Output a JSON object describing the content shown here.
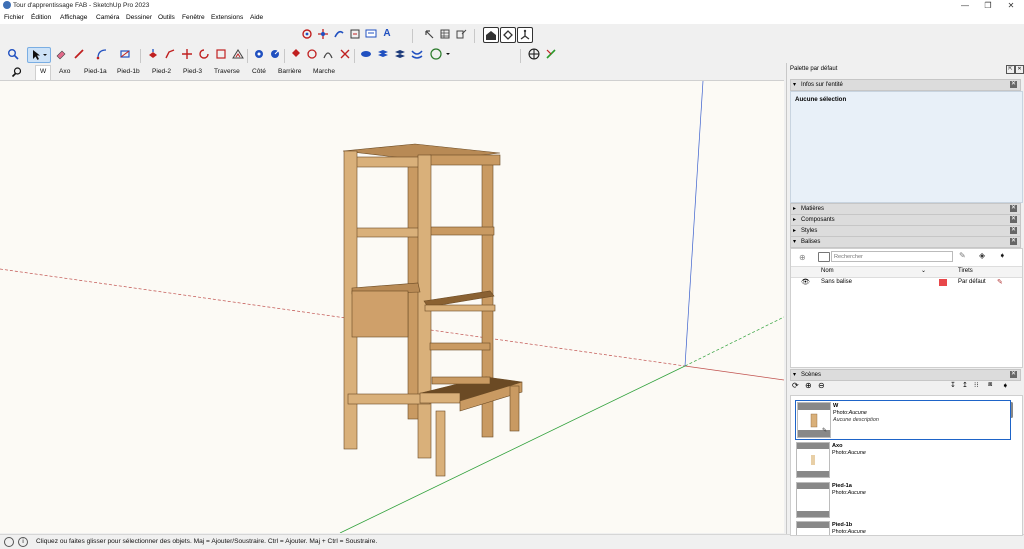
{
  "window": {
    "title": "Tour d'apprentissage FAB - SketchUp Pro 2023",
    "controls": [
      "—",
      "❐",
      "✕"
    ]
  },
  "menu": [
    "Fichier",
    "Édition",
    "Affichage",
    "Caméra",
    "Dessiner",
    "Outils",
    "Fenêtre",
    "Extensions",
    "Aide"
  ],
  "scene_tabs": {
    "search_icon": "search-icon",
    "tabs": [
      "W",
      "Axo",
      "Pied-1a",
      "Pied-1b",
      "Pied-2",
      "Pied-3",
      "Traverse",
      "Côté",
      "Barrière",
      "Marche"
    ],
    "active": "W"
  },
  "status": {
    "text": "Cliquez ou faites glisser pour sélectionner des objets. Maj = Ajouter/Soustraire. Ctrl = Ajouter. Maj + Ctrl = Soustraire."
  },
  "panel": {
    "title": "Palette par défaut",
    "entity_info": {
      "header": "Infos sur l'entité",
      "selection": "Aucune sélection"
    },
    "collapsed_sections": [
      "Matières",
      "Composants",
      "Styles"
    ],
    "tags": {
      "header": "Balises",
      "search_placeholder": "Rechercher",
      "col_name": "Nom",
      "col_dashes": "Tirets",
      "rows": [
        {
          "name": "Sans balise",
          "color": "#e8474a",
          "dashes": "Par défaut"
        }
      ]
    },
    "scenes": {
      "header": "Scènes",
      "items": [
        {
          "name": "W",
          "photo": "Photo:",
          "photo_value": "Aucune",
          "description": "Aucune description",
          "selected": true
        },
        {
          "name": "Axo",
          "photo": "Photo:",
          "photo_value": "Aucune",
          "description": "",
          "selected": false
        },
        {
          "name": "Pied-1a",
          "photo": "Photo:",
          "photo_value": "Aucune",
          "description": "",
          "selected": false
        },
        {
          "name": "Pied-1b",
          "photo": "Photo:",
          "photo_value": "Aucune",
          "description": "",
          "selected": false
        }
      ]
    }
  },
  "colors": {
    "wood_light": "#d9b07a",
    "wood_mid": "#c99a62",
    "wood_dark": "#8a6132",
    "axis_red": "#c0504d",
    "axis_green": "#2fa03a",
    "axis_blue": "#3a5fcd",
    "selection_blue": "#1e64c8"
  }
}
